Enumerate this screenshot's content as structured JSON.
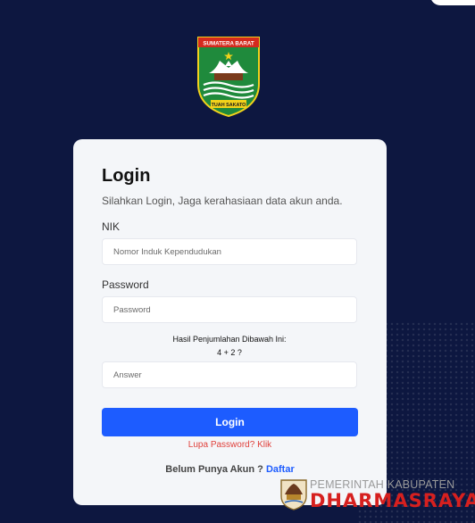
{
  "emblem": {
    "banner_top": "SUMATERA BARAT",
    "banner_bottom": "TUAH SAKATO"
  },
  "login": {
    "title": "Login",
    "subtitle": "Silahkan Login, Jaga kerahasiaan data akun anda.",
    "nik_label": "NIK",
    "nik_placeholder": "Nomor Induk Kependudukan",
    "password_label": "Password",
    "password_placeholder": "Password",
    "captcha_prompt": "Hasil Penjumlahan Dibawah Ini:",
    "captcha_question": "4 + 2 ?",
    "answer_placeholder": "Answer",
    "submit_label": "Login",
    "forgot_label": "Lupa Password? Klik",
    "register_prompt": "Belum Punya Akun ?",
    "register_link": "Daftar"
  },
  "brand": {
    "top": "PEMERINTAH KABUPATEN",
    "main": "DHARMASRAYA"
  },
  "colors": {
    "background": "#0d1740",
    "card": "#f4f6f9",
    "primary": "#1d5cff",
    "danger": "#e0413c",
    "brand_red": "#d6201f"
  },
  "icons": {
    "emblem": "west-sumatra-emblem-icon",
    "brand": "dharmasraya-logo-icon"
  }
}
